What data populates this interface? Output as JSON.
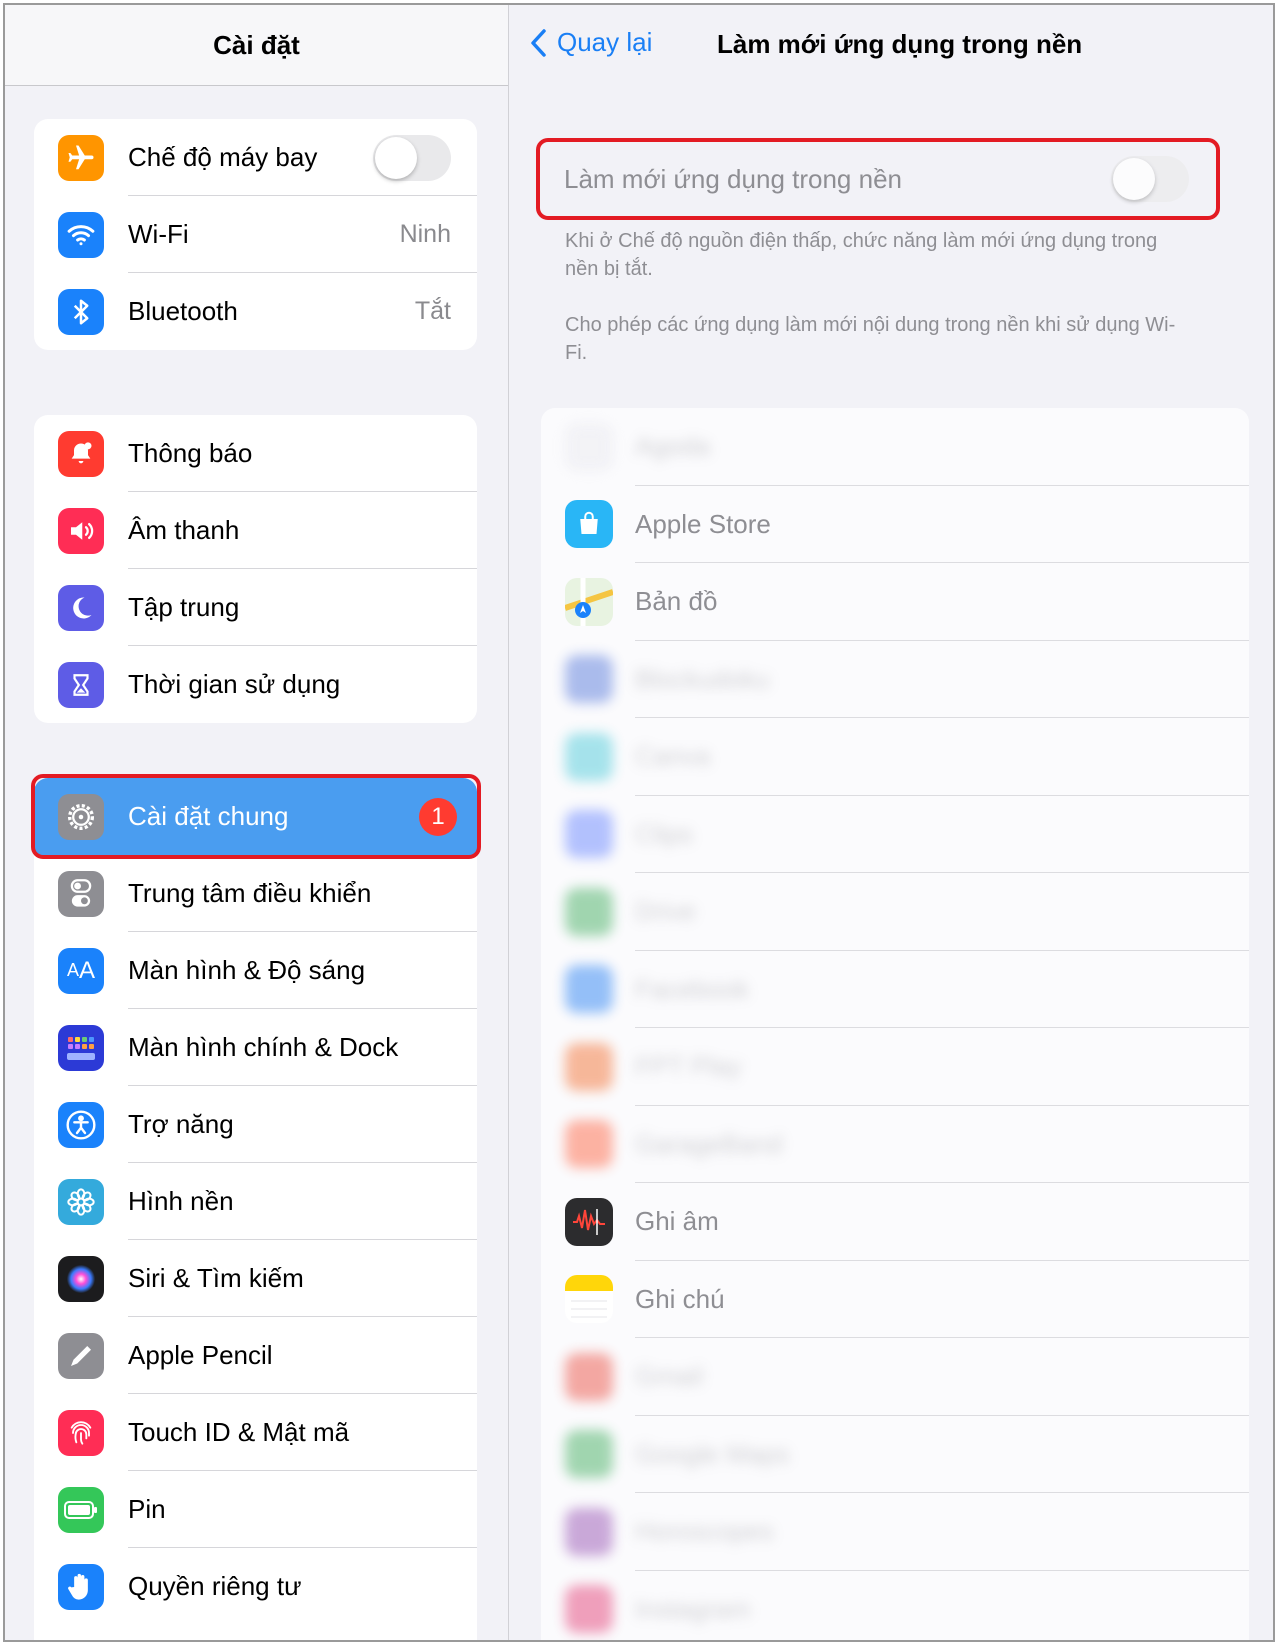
{
  "sidebar": {
    "title": "Cài đặt",
    "group1": [
      {
        "label": "Chế độ máy bay",
        "icon": "airplane-icon",
        "color": "#ff9500",
        "toggle": false
      },
      {
        "label": "Wi-Fi",
        "icon": "wifi-icon",
        "color": "#1a82fb",
        "value": "Ninh"
      },
      {
        "label": "Bluetooth",
        "icon": "bluetooth-icon",
        "color": "#1a82fb",
        "value": "Tắt"
      }
    ],
    "group2": [
      {
        "label": "Thông báo",
        "icon": "bell-icon",
        "color": "#ff3b30"
      },
      {
        "label": "Âm thanh",
        "icon": "speaker-icon",
        "color": "#ff2d55"
      },
      {
        "label": "Tập trung",
        "icon": "moon-icon",
        "color": "#5e5ce6"
      },
      {
        "label": "Thời gian sử dụng",
        "icon": "hourglass-icon",
        "color": "#5e5ce6"
      }
    ],
    "group3": [
      {
        "label": "Cài đặt chung",
        "icon": "gear-icon",
        "color": "#8e8e93",
        "badge": "1",
        "selected": true
      },
      {
        "label": "Trung tâm điều khiển",
        "icon": "switches-icon",
        "color": "#8e8e93"
      },
      {
        "label": "Màn hình & Độ sáng",
        "icon": "text-size-icon",
        "color": "#1a82fb"
      },
      {
        "label": "Màn hình chính & Dock",
        "icon": "home-grid-icon",
        "color": "#2c3ad6"
      },
      {
        "label": "Trợ năng",
        "icon": "accessibility-icon",
        "color": "#1a82fb"
      },
      {
        "label": "Hình nền",
        "icon": "flower-icon",
        "color": "#34aadc"
      },
      {
        "label": "Siri & Tìm kiếm",
        "icon": "siri-icon",
        "color": "#1c1c1e"
      },
      {
        "label": "Apple Pencil",
        "icon": "pencil-icon",
        "color": "#8e8e93"
      },
      {
        "label": "Touch ID & Mật mã",
        "icon": "fingerprint-icon",
        "color": "#ff2d55"
      },
      {
        "label": "Pin",
        "icon": "battery-icon",
        "color": "#34c759"
      },
      {
        "label": "Quyền riêng tư",
        "icon": "hand-icon",
        "color": "#1a82fb"
      }
    ]
  },
  "detail": {
    "back_label": "Quay lại",
    "title": "Làm mới ứng dụng trong nền",
    "main_toggle_label": "Làm mới ứng dụng trong nền",
    "main_toggle_on": false,
    "footnote_1": "Khi ở Chế độ nguồn điện thấp, chức năng làm mới ứng dụng trong nền bị tắt.",
    "footnote_2": "Cho phép các ứng dụng làm mới nội dung trong nền khi sử dụng Wi-Fi.",
    "apps": [
      {
        "name": "Agoda",
        "blurred": true,
        "icon": "agoda-icon",
        "color": "#e8e8ee"
      },
      {
        "name": "Apple Store",
        "blurred": false,
        "icon": "apple-store-icon",
        "color": "#29b6f6"
      },
      {
        "name": "Bản đồ",
        "blurred": false,
        "icon": "maps-icon",
        "color": "#7ccf6a"
      },
      {
        "name": "Blockudoku",
        "blurred": true,
        "icon": "blocks-icon",
        "color": "#4a6fd8"
      },
      {
        "name": "Canva",
        "blurred": true,
        "icon": "canva-icon",
        "color": "#3ec6d6"
      },
      {
        "name": "Clips",
        "blurred": true,
        "icon": "clips-icon",
        "color": "#5b7bff"
      },
      {
        "name": "Drive",
        "blurred": true,
        "icon": "drive-icon",
        "color": "#34a853"
      },
      {
        "name": "Facebook",
        "blurred": true,
        "icon": "facebook-icon",
        "color": "#1877f2"
      },
      {
        "name": "FPT Play",
        "blurred": true,
        "icon": "fpt-play-icon",
        "color": "#f26522"
      },
      {
        "name": "GarageBand",
        "blurred": true,
        "icon": "garageband-icon",
        "color": "#ff5a36"
      },
      {
        "name": "Ghi âm",
        "blurred": false,
        "icon": "voice-memo-icon",
        "color": "#2c2c2e"
      },
      {
        "name": "Ghi chú",
        "blurred": false,
        "icon": "notes-icon",
        "color": "#ffd60a"
      },
      {
        "name": "Gmail",
        "blurred": true,
        "icon": "gmail-icon",
        "color": "#ea4335"
      },
      {
        "name": "Google Maps",
        "blurred": true,
        "icon": "google-maps-icon",
        "color": "#34a853"
      },
      {
        "name": "Horoscopes",
        "blurred": true,
        "icon": "horoscope-icon",
        "color": "#8e44ad"
      },
      {
        "name": "Instagram",
        "blurred": true,
        "icon": "instagram-icon",
        "color": "#e1306c"
      }
    ]
  },
  "highlight_color": "#e31b23",
  "accent_color": "#1a7ff5"
}
